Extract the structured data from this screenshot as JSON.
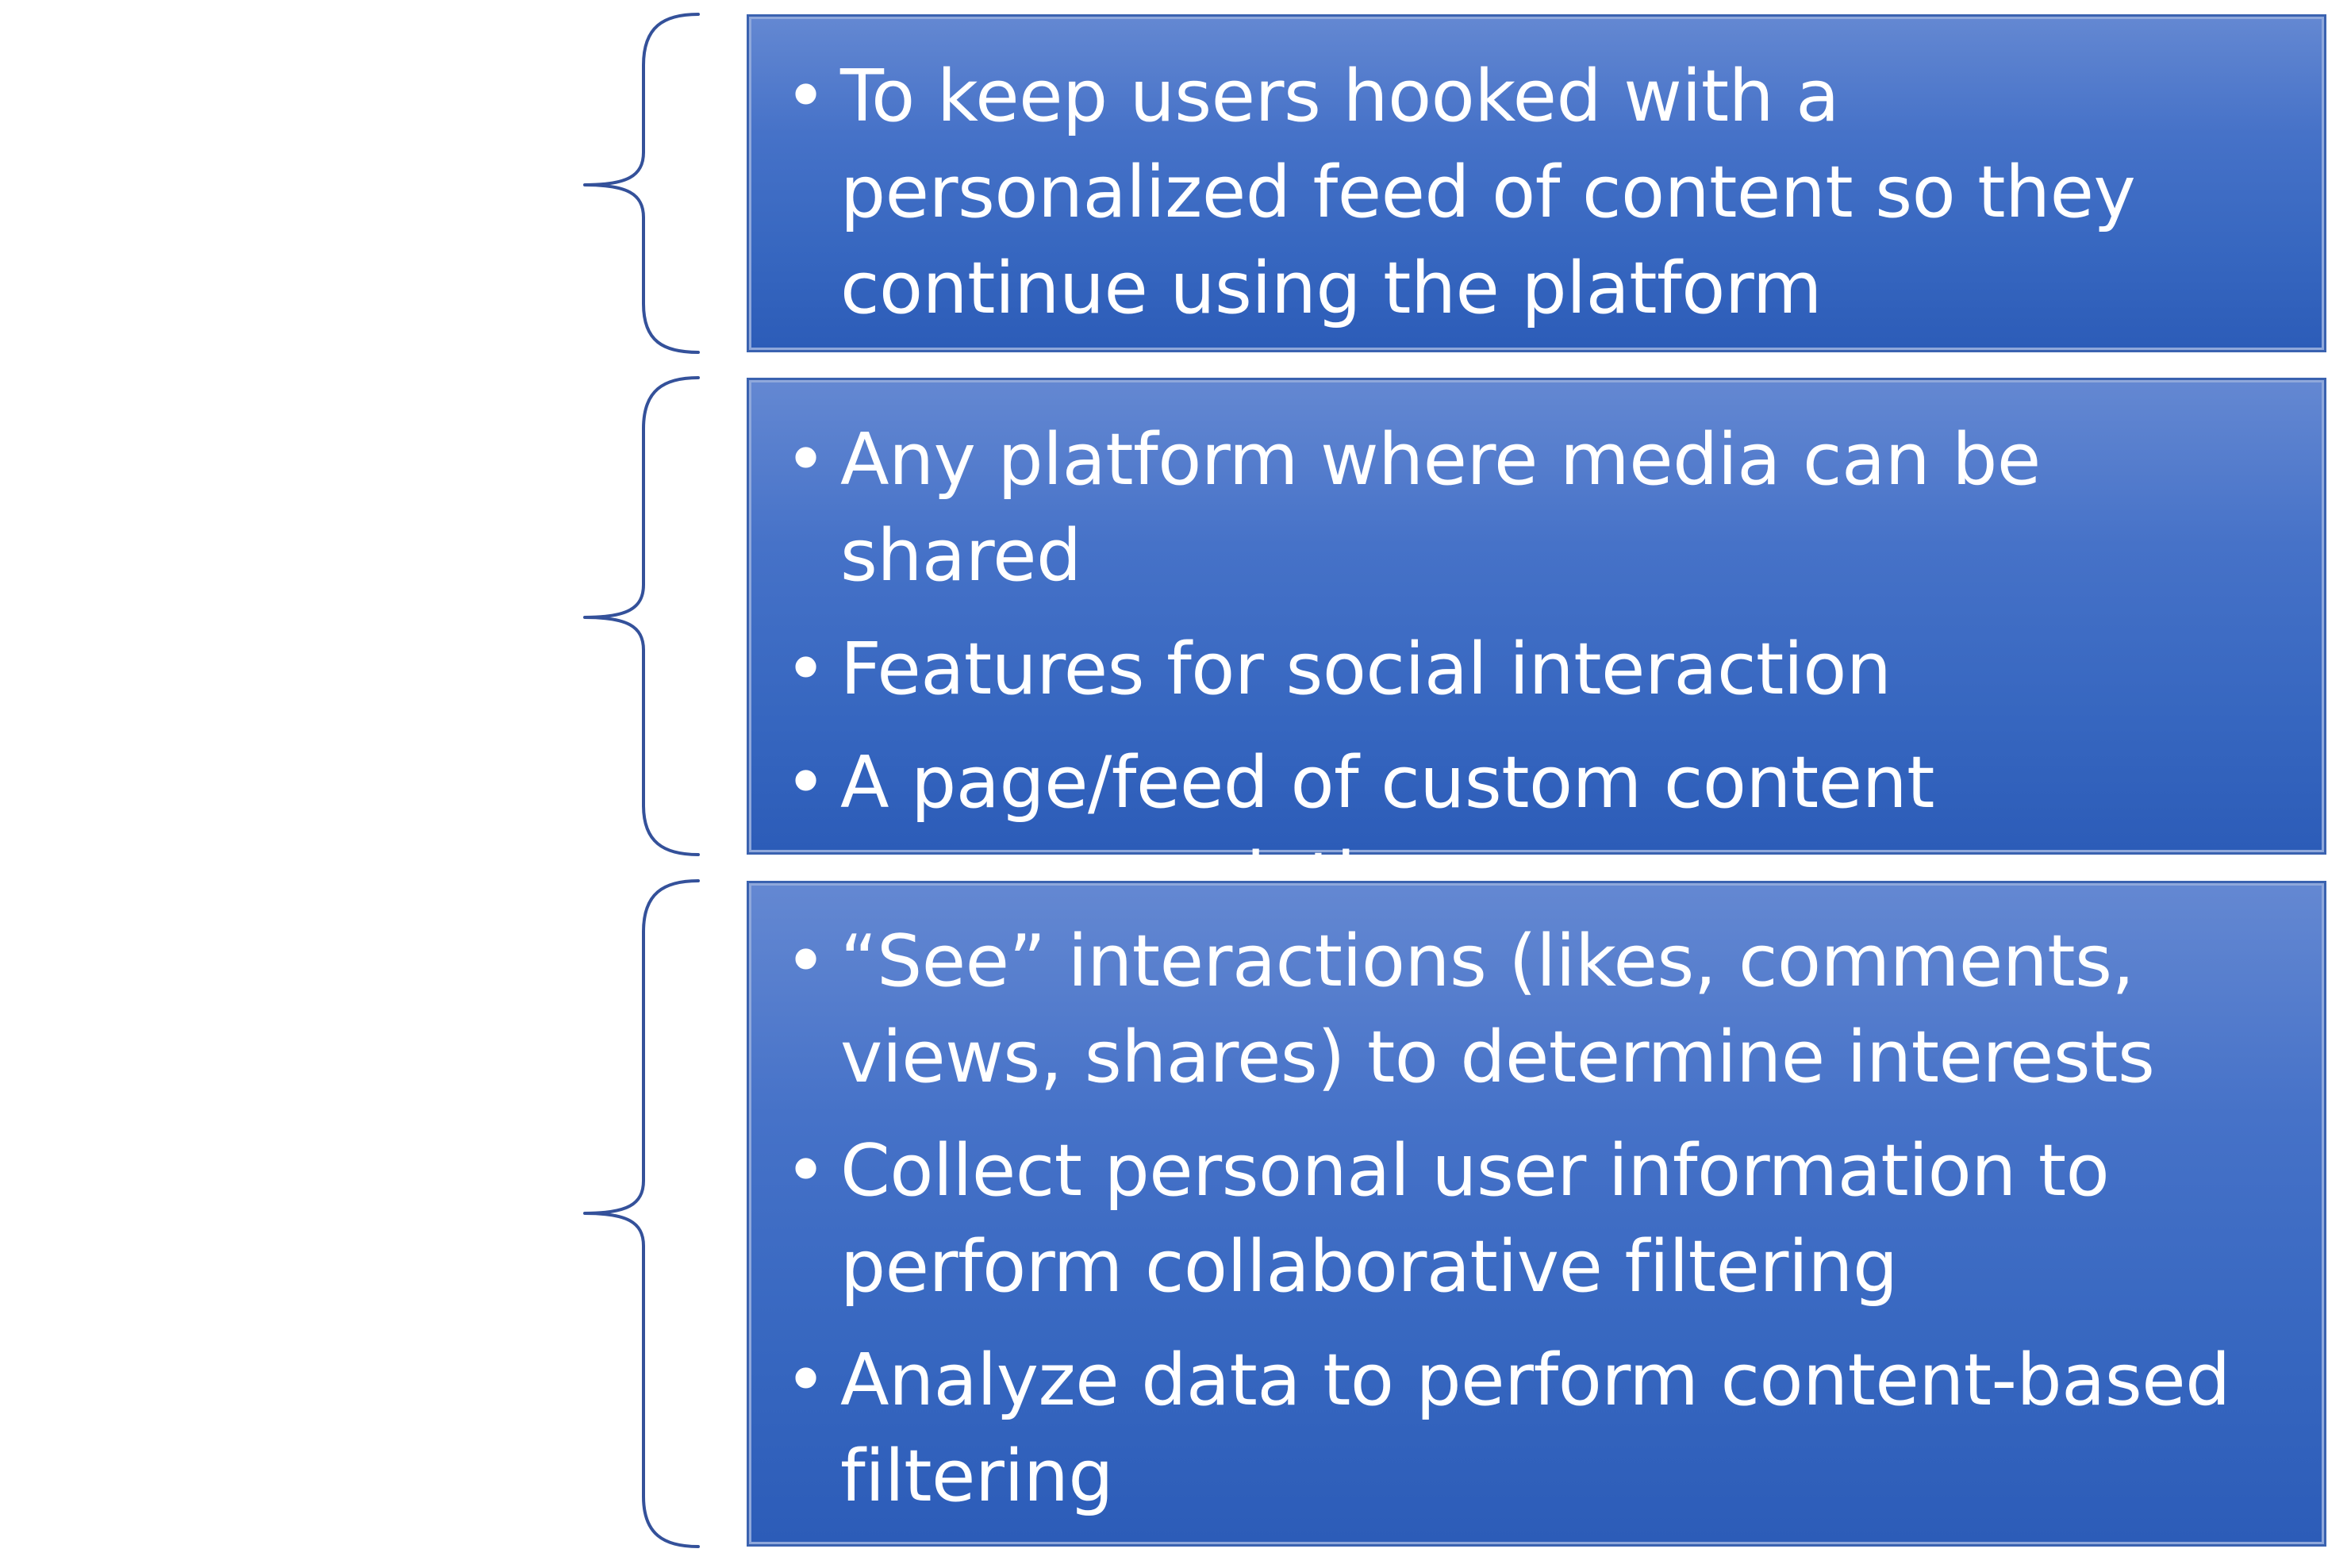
{
  "colors": {
    "box_fill_top": "#6488d2",
    "box_fill_bottom": "#2c5cb8",
    "box_border": "#3a62b0",
    "brace_stroke": "#34519a",
    "text": "#ffffff"
  },
  "bullet_glyph": "•",
  "boxes": [
    {
      "items": [
        "To keep users hooked with a personalized feed of  content so they continue using the platform"
      ]
    },
    {
      "items": [
        "Any platform where media can be shared",
        "Features for social interaction",
        "A page/feed of custom content recommendations"
      ]
    },
    {
      "items": [
        "“See” interactions (likes, comments, views, shares) to determine interests",
        "Collect personal user information to perform collaborative filtering",
        "Analyze data to perform content-based filtering"
      ]
    }
  ]
}
